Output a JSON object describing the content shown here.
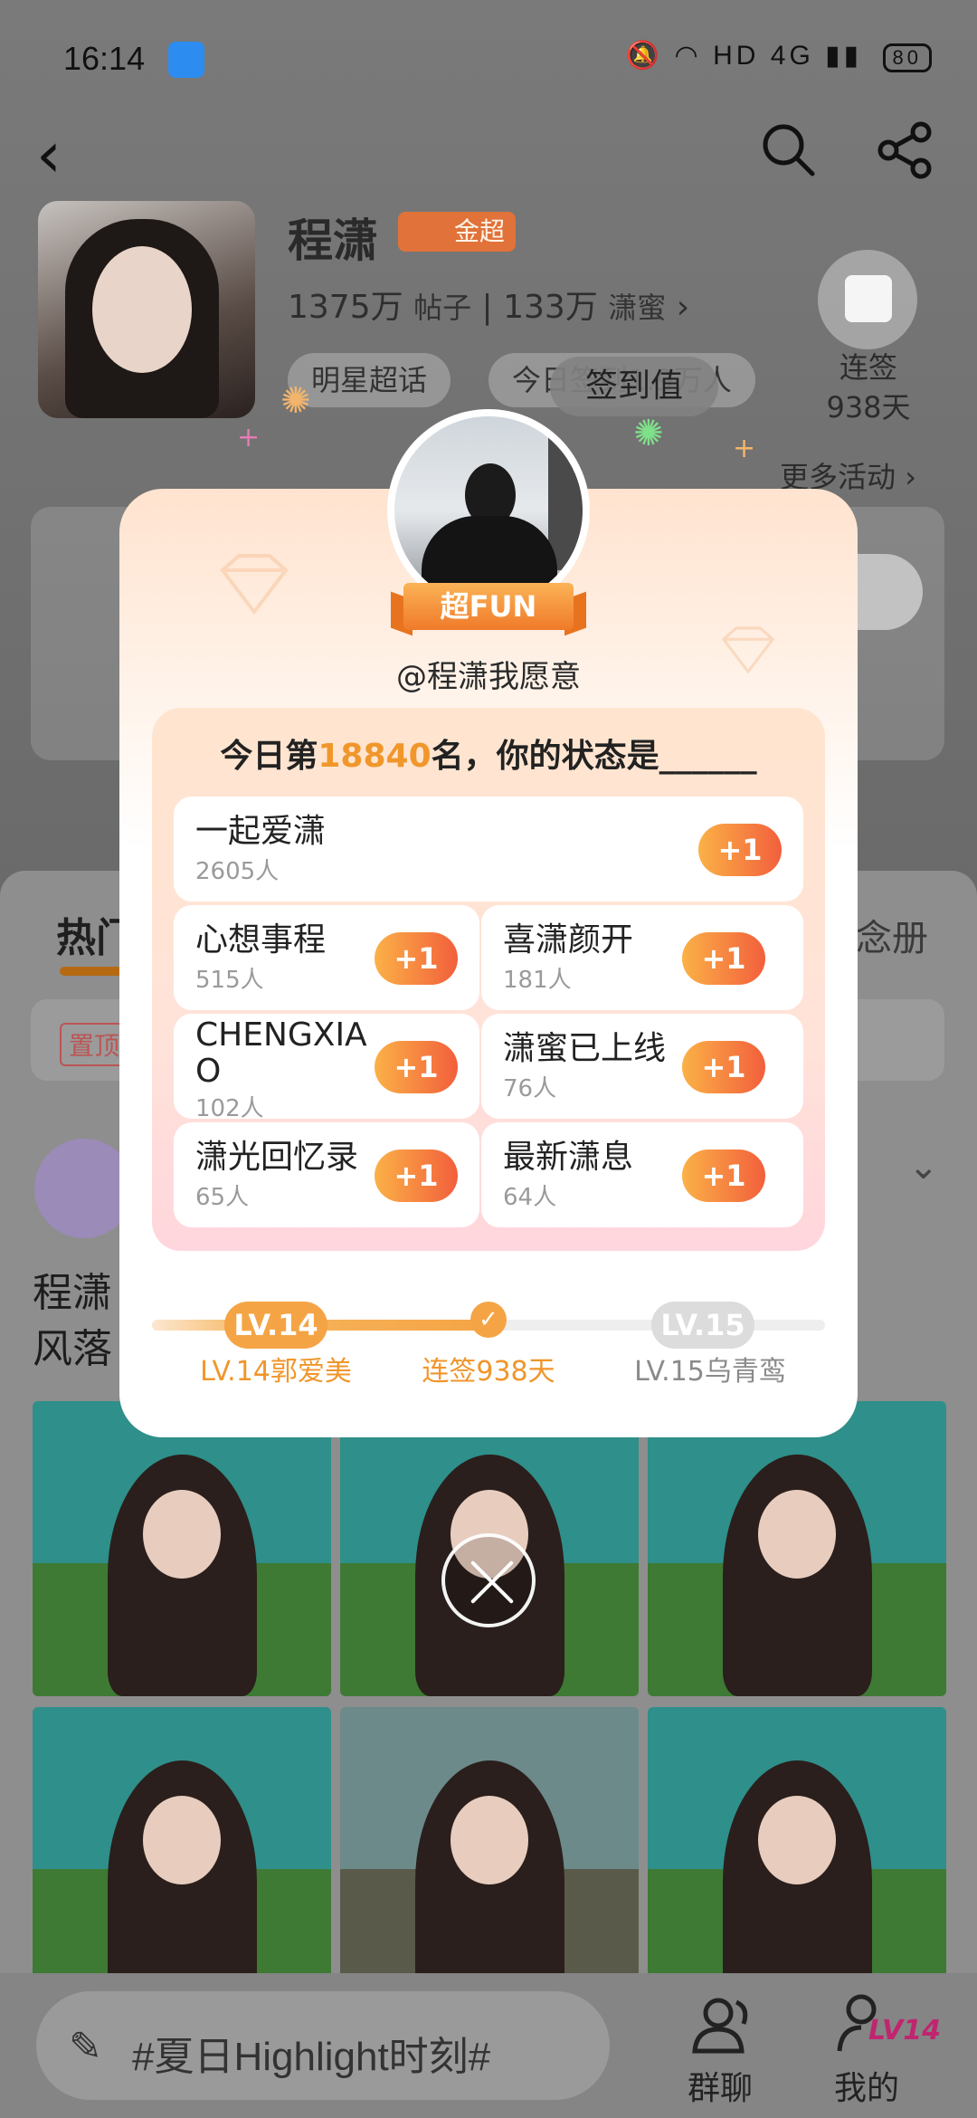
{
  "status_bar": {
    "time": "16:14",
    "network": "HD",
    "signal": "4G",
    "battery": "80"
  },
  "profile": {
    "name": "程潇",
    "badge": "金超",
    "posts_count": "1375万",
    "posts_label": "帖子",
    "fans_count": "133万",
    "fans_label": "潇蜜",
    "tag_star": "明星超话",
    "tag_today": "今日签到1.9万人",
    "signed_button": "签到值",
    "checkin_label": "连签",
    "checkin_days": "938天",
    "more_activity": "更多活动"
  },
  "background": {
    "tab_hot": "热门",
    "tab_right": "念册",
    "pinned_tag": "置顶",
    "post_text_line1": "程潇",
    "post_text_line2": "风落"
  },
  "bottom_bar": {
    "input_placeholder": "#夏日Highlight时刻#",
    "group_chat": "群聊",
    "mine": "我的",
    "level_badge": "LV14"
  },
  "popup": {
    "ribbon": "超FUN",
    "handle": "@程潇我愿意",
    "status_prefix": "今日第",
    "rank": "18840",
    "status_suffix": "名，你的状态是______",
    "options": [
      {
        "name": "一起爱潇",
        "count": "2605人",
        "button": "+1"
      },
      {
        "name": "心想事程",
        "count": "515人",
        "button": "+1"
      },
      {
        "name": "喜潇颜开",
        "count": "181人",
        "button": "+1"
      },
      {
        "name": "CHENGXIAO",
        "count": "102人",
        "button": "+1"
      },
      {
        "name": "潇蜜已上线",
        "count": "76人",
        "button": "+1"
      },
      {
        "name": "潇光回忆录",
        "count": "65人",
        "button": "+1"
      },
      {
        "name": "最新潇息",
        "count": "64人",
        "button": "+1"
      }
    ],
    "level": {
      "current_pill": "LV.14",
      "next_pill": "LV.15",
      "current_label": "LV.14郭爱美",
      "streak_label": "连签938天",
      "next_label": "LV.15乌青鸾",
      "progress": 0.5
    }
  },
  "colors": {
    "accent_orange": "#f0962b",
    "plus_gradient_start": "#fbb147",
    "plus_gradient_end": "#f25f3c",
    "level_next_gray": "#dcdcdc"
  }
}
